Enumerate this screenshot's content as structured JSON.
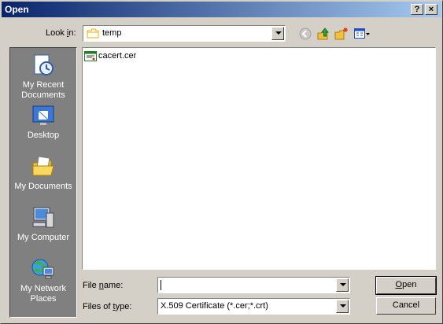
{
  "title_bar": {
    "title": "Open",
    "help_label": "?",
    "close_label": "×"
  },
  "look_in": {
    "label_before": "Look ",
    "label_accel": "i",
    "label_after": "n:",
    "value": "temp",
    "folder_icon": "folder-icon"
  },
  "toolbar": {
    "icons": [
      "back-icon",
      "up-folder-icon",
      "new-folder-icon",
      "view-menu-icon"
    ]
  },
  "places": [
    {
      "label": "My Recent Documents",
      "icon": "recent-documents-icon"
    },
    {
      "label": "Desktop",
      "icon": "desktop-icon"
    },
    {
      "label": "My Documents",
      "icon": "my-documents-icon"
    },
    {
      "label": "My Computer",
      "icon": "my-computer-icon"
    },
    {
      "label": "My Network Places",
      "icon": "network-places-icon"
    }
  ],
  "files": [
    {
      "name": "cacert.cer",
      "icon": "certificate-icon"
    }
  ],
  "file_name": {
    "label_before": "File ",
    "label_accel": "n",
    "label_after": "ame:",
    "value": ""
  },
  "files_of_type": {
    "label_before": "Files of ",
    "label_accel": "t",
    "label_after": "ype:",
    "value": "X.509 Certificate (*.cer;*.crt)"
  },
  "buttons": {
    "open_accel": "O",
    "open_rest": "pen",
    "cancel": "Cancel"
  },
  "colors": {
    "titlebar_start": "#0a246a",
    "titlebar_end": "#a6caf0",
    "dialog_bg": "#d4d0c8",
    "places_bg": "#808080"
  }
}
